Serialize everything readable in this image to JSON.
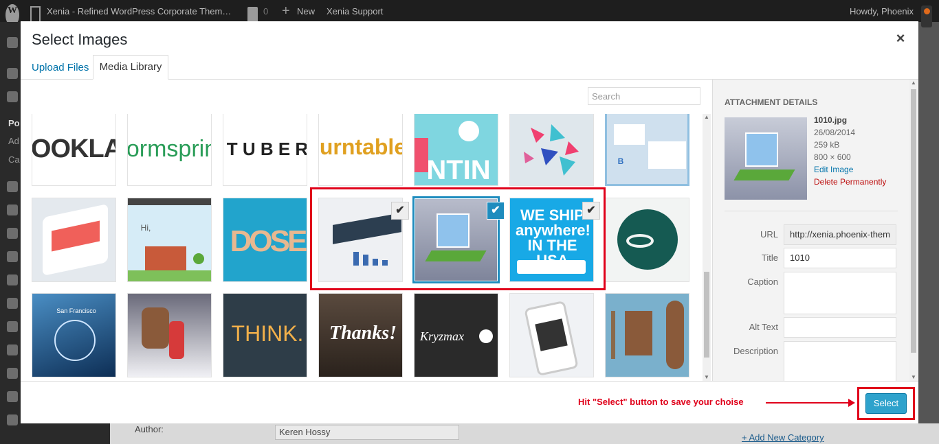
{
  "admin_bar": {
    "site_name": "Xenia - Refined WordPress Corporate Them…",
    "comments_count": "0",
    "new_label": "New",
    "support_label": "Xenia Support",
    "greeting": "Howdy, Phoenix"
  },
  "admin_menu": {
    "items": [
      "Po",
      "Ad",
      "Ca"
    ]
  },
  "modal": {
    "title": "Select Images",
    "close": "×",
    "tabs": [
      "Upload Files",
      "Media Library"
    ],
    "search_placeholder": "Search",
    "thumbnails": [
      {
        "name": "ookla",
        "text": "OOKLA"
      },
      {
        "name": "formspring",
        "text": "ormsprin"
      },
      {
        "name": "tuber",
        "text": "T U B E R"
      },
      {
        "name": "turntable",
        "text": "urntable"
      },
      {
        "name": "valentine",
        "text": "NTIN"
      },
      {
        "name": "triangles",
        "text": ""
      },
      {
        "name": "bencil",
        "text": "B"
      },
      {
        "name": "phone-app",
        "text": ""
      },
      {
        "name": "house-site",
        "text": "Hi,"
      },
      {
        "name": "dose",
        "text": "DOSE"
      },
      {
        "name": "dashboard",
        "text": ""
      },
      {
        "name": "iso-building",
        "text": ""
      },
      {
        "name": "we-ship",
        "text": "WE SHIP anywhere! IN THE USA"
      },
      {
        "name": "wave-logo",
        "text": ""
      },
      {
        "name": "weather-app",
        "text": "San Francisco"
      },
      {
        "name": "reindeer",
        "text": ""
      },
      {
        "name": "think",
        "text": "THINK."
      },
      {
        "name": "thanks",
        "text": "Thanks!"
      },
      {
        "name": "kryzmax",
        "text": "Kryzmax"
      },
      {
        "name": "phone-hand",
        "text": ""
      },
      {
        "name": "skateboard",
        "text": ""
      }
    ],
    "details": {
      "heading": "Attachment Details",
      "filename": "1010.jpg",
      "date": "26/08/2014",
      "size": "259 kB",
      "dimensions": "800 × 600",
      "edit_link": "Edit Image",
      "delete_link": "Delete Permanently",
      "fields": {
        "url_label": "URL",
        "url_value": "http://xenia.phoenix-them",
        "title_label": "Title",
        "title_value": "1010",
        "caption_label": "Caption",
        "alt_label": "Alt Text",
        "description_label": "Description"
      }
    },
    "hint": "Hit \"Select\" button to save your choise",
    "select_label": "Select"
  },
  "behind": {
    "author_label": "Author:",
    "author_value": "Keren Hossy",
    "add_category": "+ Add New Category"
  },
  "colors": {
    "accent": "#2ea2cc",
    "annotation": "#e0001a",
    "link": "#0073aa"
  }
}
